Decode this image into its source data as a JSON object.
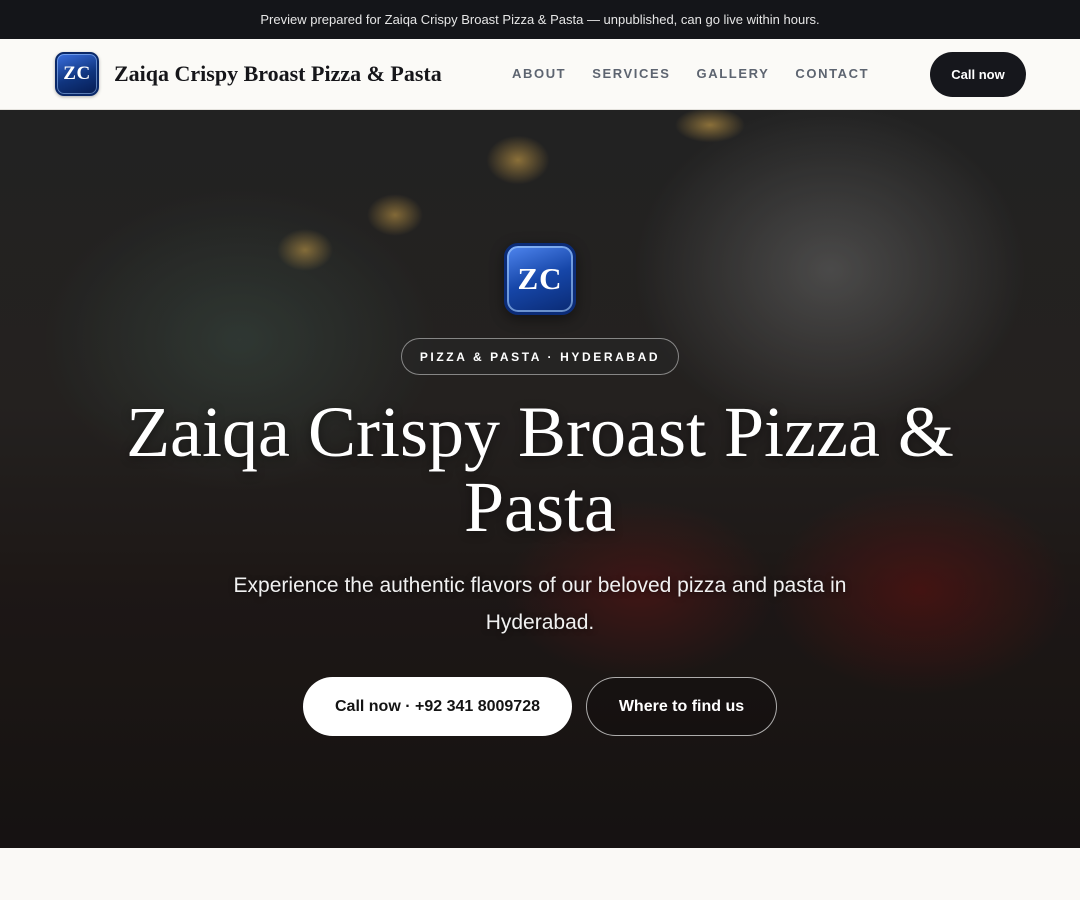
{
  "preview_bar": {
    "text": "Preview prepared for Zaiqa Crispy Broast Pizza & Pasta — unpublished, can go live within hours."
  },
  "header": {
    "logo_text": "ZC",
    "brand_name": "Zaiqa Crispy Broast Pizza & Pasta",
    "nav": [
      "ABOUT",
      "SERVICES",
      "GALLERY",
      "CONTACT"
    ],
    "cta_label": "Call now"
  },
  "hero": {
    "logo_text": "ZC",
    "tagline": "PIZZA & PASTA · HYDERABAD",
    "title": "Zaiqa Crispy Broast Pizza & Pasta",
    "subtitle": "Experience the authentic flavors of our beloved pizza and pasta in Hyderabad.",
    "primary_button": "Call now · +92 341 8009728",
    "secondary_button": "Where to find us",
    "background_image": "restaurant-interior-photo"
  },
  "colors": {
    "preview_bar_bg": "#141519",
    "header_bg": "#fbfaf7",
    "cta_bg": "#16171c",
    "logo_blue": "#1646a8",
    "page_bg": "#faf9f6"
  }
}
